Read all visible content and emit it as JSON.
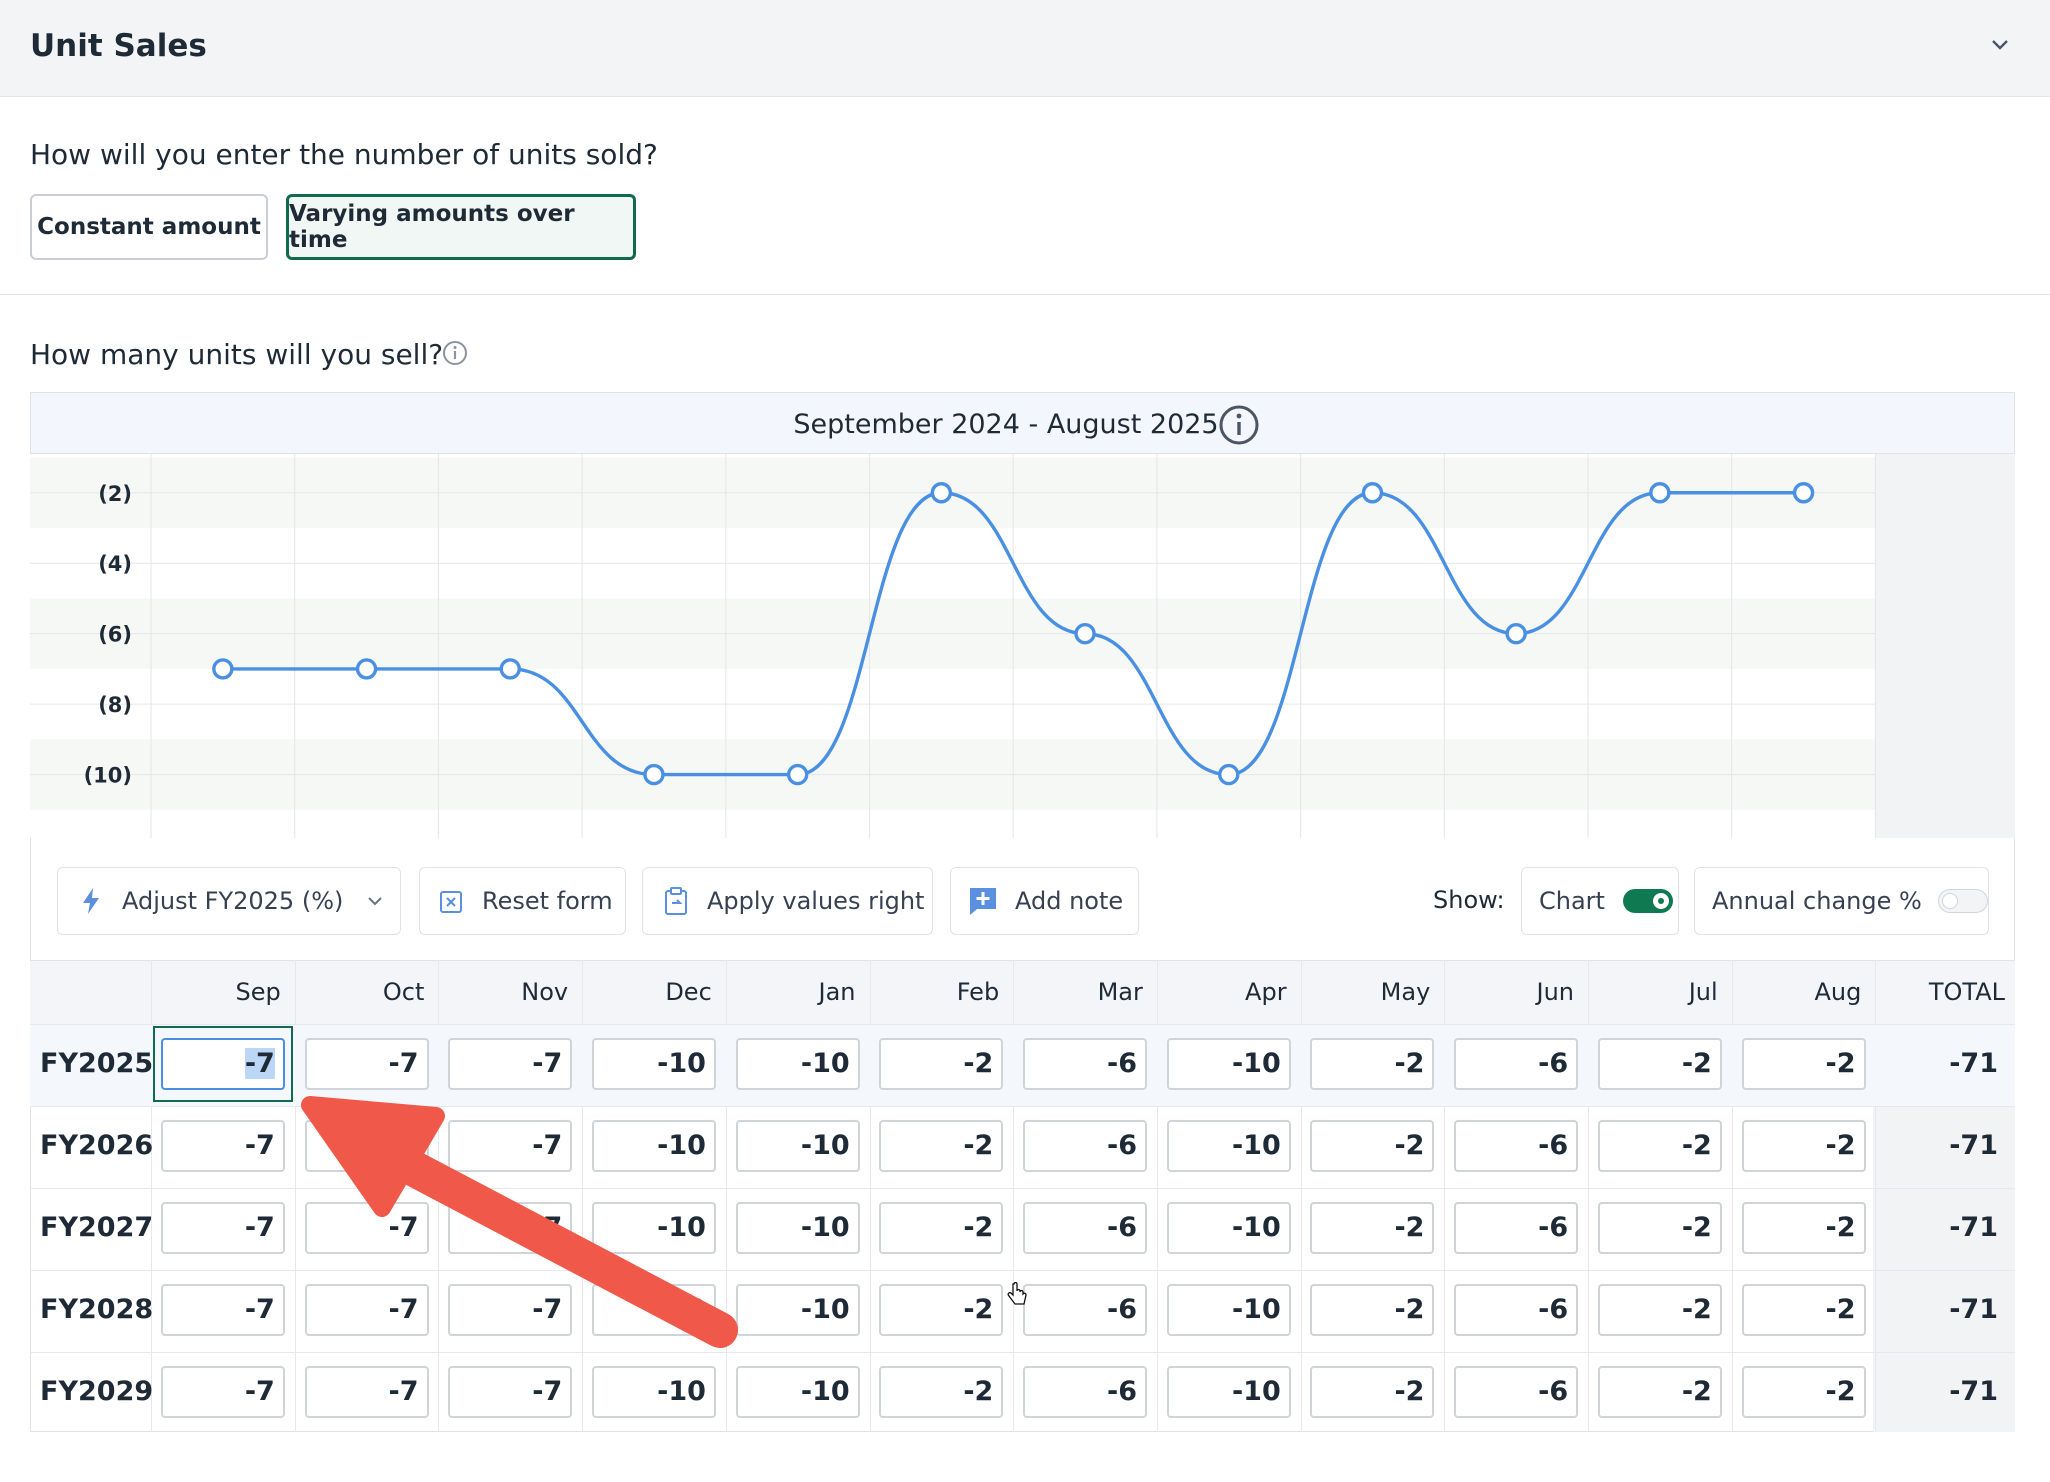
{
  "section": {
    "title": "Unit Sales"
  },
  "entry_question": "How will you enter the number of units sold?",
  "entry_options": {
    "constant": "Constant amount",
    "varying": "Varying amounts over time",
    "selected": "varying"
  },
  "units_question": "How many units will you sell?",
  "range_title": "September 2024 - August 2025",
  "chart_data": {
    "type": "line",
    "categories": [
      "Sep",
      "Oct",
      "Nov",
      "Dec",
      "Jan",
      "Feb",
      "Mar",
      "Apr",
      "May",
      "Jun",
      "Jul",
      "Aug"
    ],
    "values": [
      -7,
      -7,
      -7,
      -10,
      -10,
      -2,
      -6,
      -10,
      -2,
      -6,
      -2,
      -2
    ],
    "ytick_labels": [
      "(2)",
      "(4)",
      "(6)",
      "(8)",
      "(10)"
    ],
    "yticks": [
      -2,
      -4,
      -6,
      -8,
      -10
    ],
    "ylim": [
      -11.8,
      -0.9
    ],
    "color": "#4a90e2",
    "grid": true
  },
  "toolbar": {
    "adjust_label": "Adjust FY2025 (%)",
    "reset_label": "Reset form",
    "apply_label": "Apply values right",
    "note_label": "Add note",
    "show_label": "Show:",
    "chart_toggle_label": "Chart",
    "chart_toggle_on": true,
    "annual_toggle_label": "Annual change %",
    "annual_toggle_on": false
  },
  "table": {
    "months": [
      "Sep",
      "Oct",
      "Nov",
      "Dec",
      "Jan",
      "Feb",
      "Mar",
      "Apr",
      "May",
      "Jun",
      "Jul",
      "Aug"
    ],
    "total_header": "TOTAL",
    "rows": [
      {
        "label": "FY2025",
        "values": [
          "-7",
          "-7",
          "-7",
          "-10",
          "-10",
          "-2",
          "-6",
          "-10",
          "-2",
          "-6",
          "-2",
          "-2"
        ],
        "total": "-71"
      },
      {
        "label": "FY2026",
        "values": [
          "-7",
          "-7",
          "-7",
          "-10",
          "-10",
          "-2",
          "-6",
          "-10",
          "-2",
          "-6",
          "-2",
          "-2"
        ],
        "total": "-71"
      },
      {
        "label": "FY2027",
        "values": [
          "-7",
          "-7",
          "-7",
          "-10",
          "-10",
          "-2",
          "-6",
          "-10",
          "-2",
          "-6",
          "-2",
          "-2"
        ],
        "total": "-71"
      },
      {
        "label": "FY2028",
        "values": [
          "-7",
          "-7",
          "-7",
          "-10",
          "-10",
          "-2",
          "-6",
          "-10",
          "-2",
          "-6",
          "-2",
          "-2"
        ],
        "total": "-71"
      },
      {
        "label": "FY2029",
        "values": [
          "-7",
          "-7",
          "-7",
          "-10",
          "-10",
          "-2",
          "-6",
          "-10",
          "-2",
          "-6",
          "-2",
          "-2"
        ],
        "total": "-71"
      }
    ]
  },
  "colors": {
    "accent": "#0f6b4c",
    "line": "#4a90e2",
    "arrow": "#f0584a"
  }
}
